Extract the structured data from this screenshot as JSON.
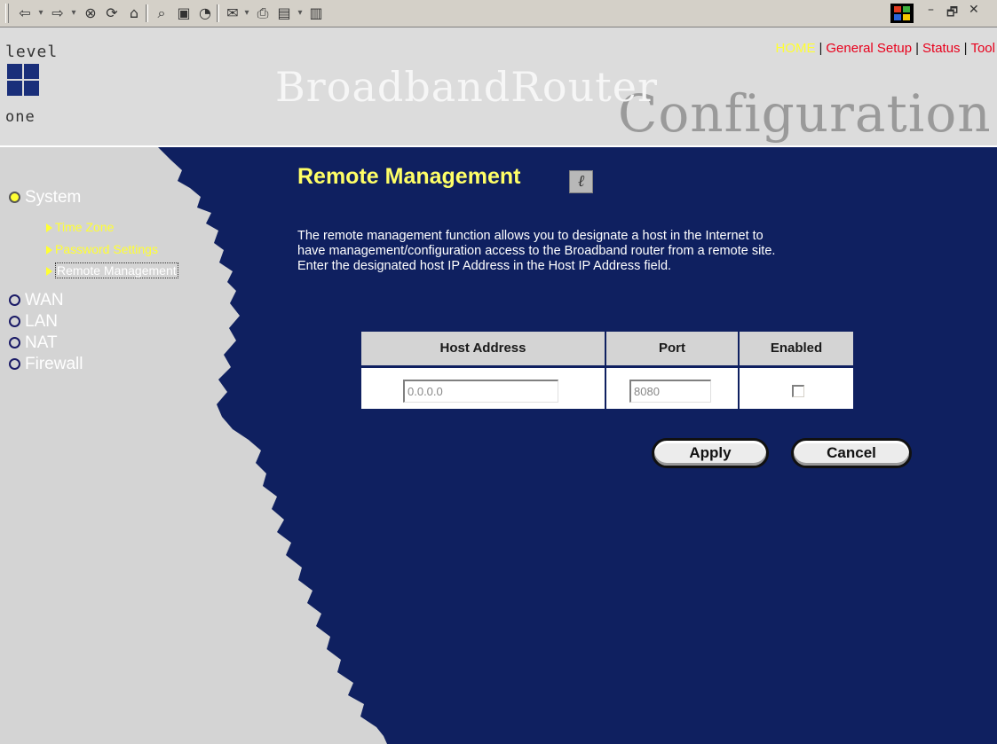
{
  "toolbar": {
    "icons": [
      "back-arrow-icon",
      "forward-arrow-icon",
      "stop-icon",
      "refresh-icon",
      "home-icon",
      "search-icon",
      "favorites-icon",
      "history-icon",
      "mail-icon",
      "print-icon",
      "edit-icon",
      "discuss-icon"
    ],
    "window_buttons": [
      "_",
      "🗗",
      "✕"
    ]
  },
  "header": {
    "logo_top": "level",
    "logo_bottom": "one",
    "brand_title": "BroadbandRouter",
    "brand_subtitle": "Configuration",
    "nav": [
      {
        "label": "HOME",
        "color": "#ffff33"
      },
      {
        "label": "General Setup",
        "color": "#e8001c"
      },
      {
        "label": "Status",
        "color": "#e8001c"
      },
      {
        "label": "Tool",
        "color": "#e8001c"
      }
    ],
    "nav_separator": "|"
  },
  "sidebar": {
    "items": [
      {
        "label": "System",
        "active": true,
        "children": [
          {
            "label": "Time Zone",
            "active": false
          },
          {
            "label": "Password Settings",
            "active": false
          },
          {
            "label": "Remote Management",
            "active": true
          }
        ]
      },
      {
        "label": "WAN",
        "active": false
      },
      {
        "label": "LAN",
        "active": false
      },
      {
        "label": "NAT",
        "active": false
      },
      {
        "label": "Firewall",
        "active": false
      }
    ]
  },
  "main": {
    "title": "Remote Management",
    "help_icon": "help-icon",
    "description": [
      "The remote management function allows you to designate a host in the Internet to",
      "have management/configuration access to the Broadband router from a remote site.",
      "Enter the designated host IP Address in the Host IP Address field."
    ],
    "table": {
      "headers": [
        "Host Address",
        "Port",
        "Enabled"
      ],
      "host_address": "0.0.0.0",
      "port": "8080",
      "enabled": false
    },
    "buttons": {
      "apply": "Apply",
      "cancel": "Cancel"
    }
  },
  "colors": {
    "content_bg": "#0f2060",
    "title": "#ffff66",
    "nav_link": "#e8001c",
    "nav_home": "#ffff33",
    "sidebar_bg": "#d4d4d4"
  }
}
